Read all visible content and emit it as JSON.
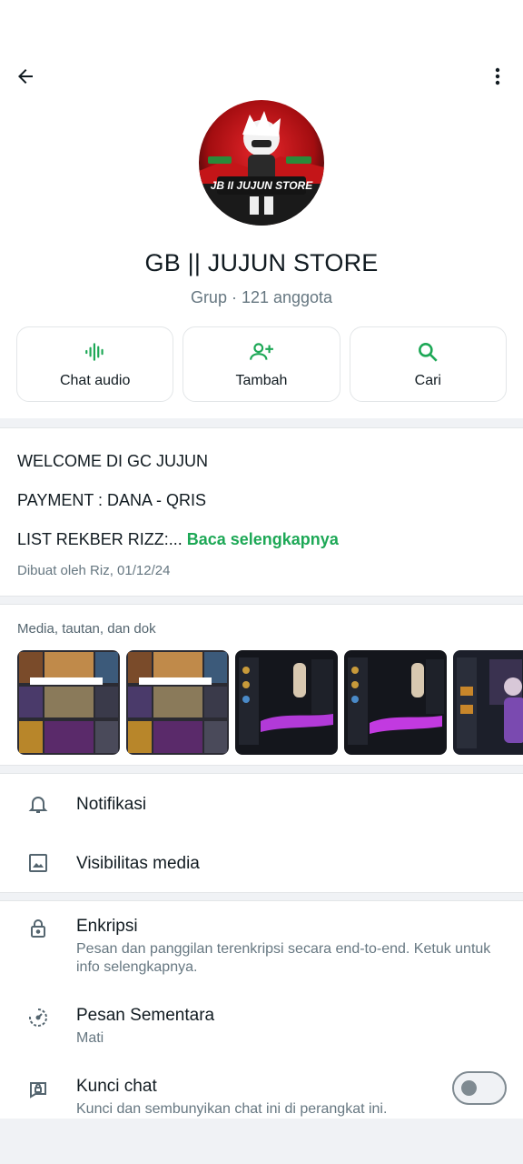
{
  "group": {
    "name": "GB || JUJUN STORE",
    "subtitle": "Grup · 121 anggota",
    "avatar_text": "JB II JUJUN STORE"
  },
  "actions": [
    {
      "label": "Chat audio",
      "icon": "audio-wave-icon"
    },
    {
      "label": "Tambah",
      "icon": "add-person-icon"
    },
    {
      "label": "Cari",
      "icon": "search-icon"
    }
  ],
  "description": {
    "line1": "WELCOME DI GC JUJUN",
    "line2": "PAYMENT : DANA - QRIS",
    "line3": "LIST REKBER RIZZ:...",
    "read_more": "Baca selengkapnya",
    "created": "Dibuat oleh Riz, 01/12/24"
  },
  "media": {
    "title": "Media, tautan, dan dok",
    "thumbs": [
      "media-thumb-1",
      "media-thumb-2",
      "media-thumb-3",
      "media-thumb-4",
      "media-thumb-5"
    ]
  },
  "settings": {
    "notifications": {
      "title": "Notifikasi"
    },
    "media_visibility": {
      "title": "Visibilitas media"
    },
    "encryption": {
      "title": "Enkripsi",
      "subtitle": "Pesan dan panggilan terenkripsi secara end-to-end. Ketuk untuk info selengkapnya."
    },
    "disappearing": {
      "title": "Pesan Sementara",
      "subtitle": "Mati"
    },
    "chat_lock": {
      "title": "Kunci chat",
      "subtitle": "Kunci dan sembunyikan chat ini di perangkat ini.",
      "enabled": false
    }
  },
  "colors": {
    "accent": "#1da856",
    "text": "#111b21",
    "secondary": "#667781"
  }
}
